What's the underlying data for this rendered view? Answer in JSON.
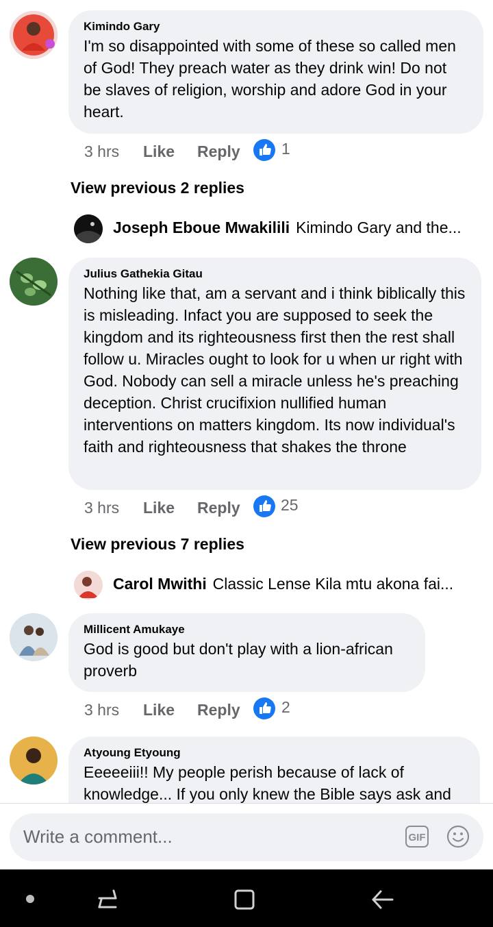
{
  "comments": [
    {
      "name": "Kimindo Gary",
      "text": "I'm so disappointed with some of these so called men of God! They preach water as they drink win! Do not be slaves of religion, worship and adore God in your heart.",
      "time": "3 hrs",
      "like": "Like",
      "reply": "Reply",
      "reactions": "1",
      "view_previous": "View previous 2 replies",
      "latest_reply": {
        "name": "Joseph Eboue Mwakilili",
        "text": "Kimindo Gary and the..."
      }
    },
    {
      "name": "Julius Gathekia Gitau",
      "text": "Nothing like that, am a servant and i think biblically this is misleading. Infact you are supposed to seek the kingdom and its righteousness first then the rest shall follow u. Miracles ought to look for u when ur right with God. Nobody can sell a miracle unless he's preaching deception. Christ crucifixion nullified human interventions on matters kingdom. Its now individual's faith and righteousness  that shakes the throne",
      "time": "3 hrs",
      "like": "Like",
      "reply": "Reply",
      "reactions": "25",
      "view_previous": "View previous 7 replies",
      "latest_reply": {
        "name": "Carol Mwithi",
        "text": "Classic Lense Kila mtu akona fai..."
      }
    },
    {
      "name": "Millicent Amukaye",
      "text": "God is good but don't play with a lion-african proverb",
      "time": "3 hrs",
      "like": "Like",
      "reply": "Reply",
      "reactions": "2"
    },
    {
      "name": "Atyoung Etyoung",
      "text": "Eeeeeiii!! My people perish because of lack of knowledge... If you only knew the Bible says ask and"
    }
  ],
  "composer": {
    "placeholder": "Write a comment...",
    "gif_label": "GIF"
  },
  "icons": {
    "like": "thumbs-up-icon",
    "emoji": "smiley-icon",
    "gif": "gif-icon",
    "nav": [
      "dot-icon",
      "recents-icon",
      "home-icon",
      "back-icon"
    ]
  },
  "colors": {
    "accent": "#1877f2",
    "bubble": "#eff1f4",
    "meta": "#65676b"
  }
}
